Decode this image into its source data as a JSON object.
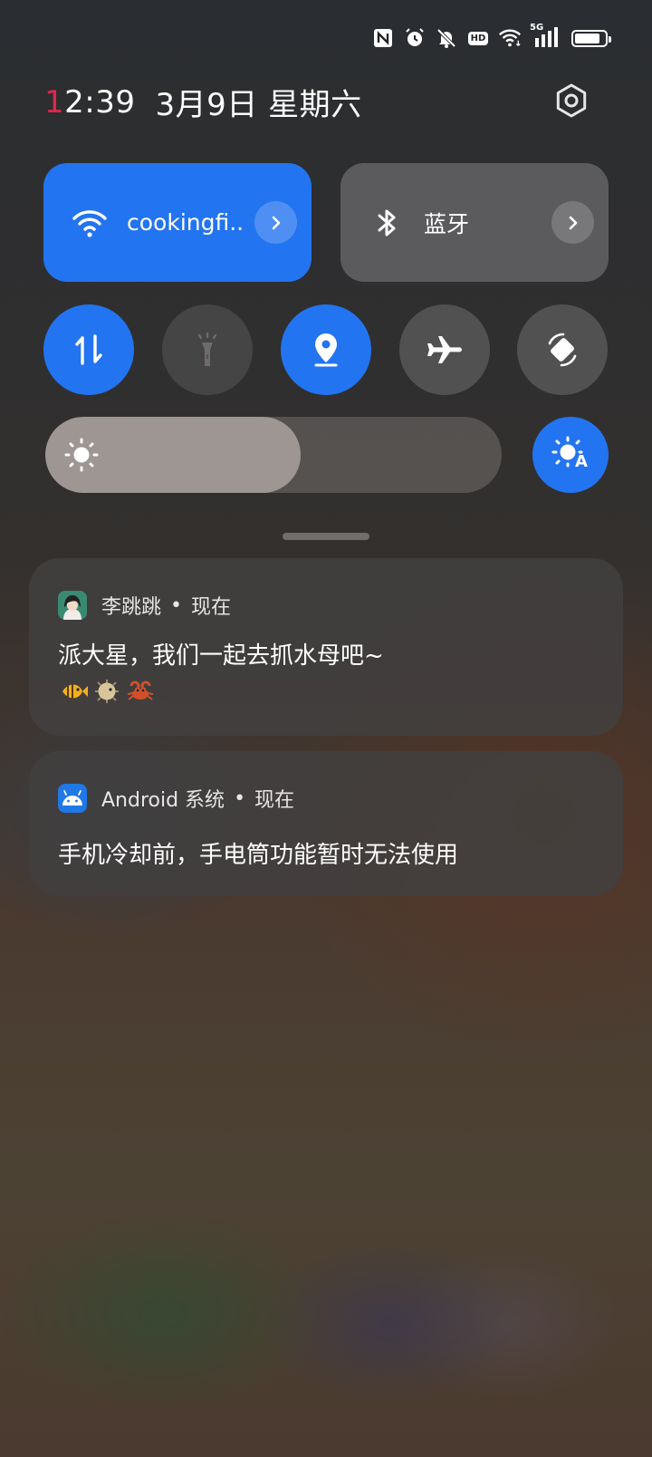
{
  "status_bar": {
    "icons": [
      "nfc-icon",
      "alarm-icon",
      "mute-notifications-icon",
      "hd-icon",
      "wifi-signal-icon",
      "5g-signal-icon",
      "battery-icon"
    ],
    "hd_label": "HD",
    "network_label": "5G",
    "battery_level": 0.85
  },
  "header": {
    "time_first_digit": "1",
    "time_rest": "2:39",
    "date": "3月9日 星期六"
  },
  "quick_tiles": {
    "wifi": {
      "label": "cookingfi..",
      "active": true
    },
    "bluetooth": {
      "label": "蓝牙",
      "active": false
    }
  },
  "toggles": [
    {
      "name": "mobile-data",
      "icon": "data-arrows-icon",
      "active": true
    },
    {
      "name": "flashlight",
      "icon": "flashlight-icon",
      "active": false,
      "disabled": true
    },
    {
      "name": "location",
      "icon": "location-pin-icon",
      "active": true
    },
    {
      "name": "airplane-mode",
      "icon": "airplane-icon",
      "active": false
    },
    {
      "name": "auto-rotate",
      "icon": "rotate-icon",
      "active": false
    }
  ],
  "brightness": {
    "level": 0.56,
    "auto_label": "A",
    "auto_active": true
  },
  "notifications": [
    {
      "app": "李跳跳",
      "time": "现在",
      "body": "派大星，我们一起去抓水母吧~",
      "emojis": [
        "tropical-fish-emoji",
        "blowfish-emoji",
        "crab-emoji"
      ]
    },
    {
      "app": "Android 系统",
      "time": "现在",
      "body": "手机冷却前，手电筒功能暂时无法使用"
    }
  ],
  "separator": "•",
  "colors": {
    "accent": "#2374f0",
    "time_highlight": "#e0264a"
  }
}
